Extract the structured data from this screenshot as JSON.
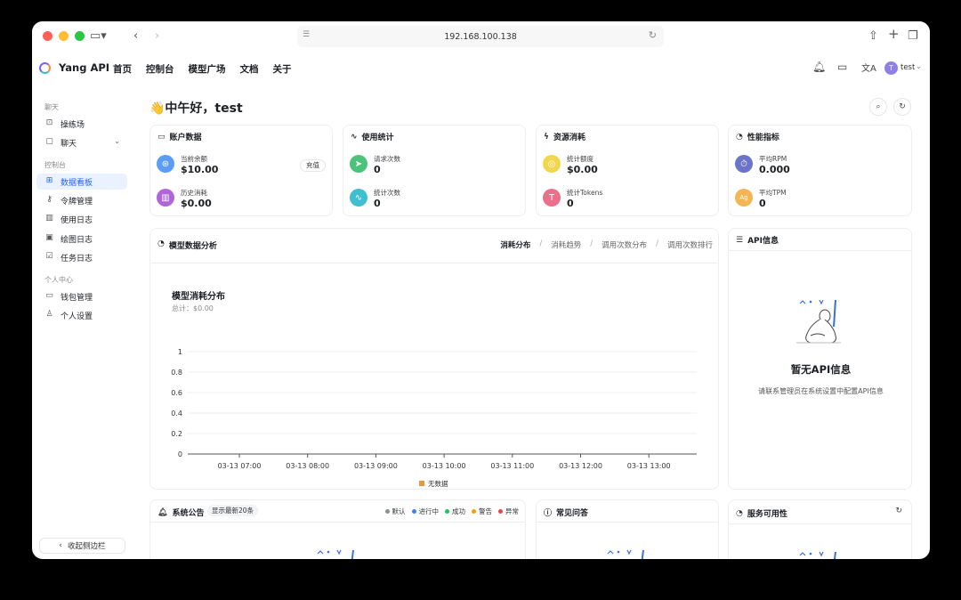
{
  "browser": {
    "url": "192.168.100.138"
  },
  "header": {
    "brand": "Yang API",
    "nav": [
      "首页",
      "控制台",
      "模型广场",
      "文档",
      "关于"
    ],
    "user_initial": "T",
    "user_name": "test"
  },
  "sidebar": {
    "sections": {
      "chat": "聊天",
      "console": "控制台",
      "personal": "个人中心"
    },
    "items": [
      {
        "label": "操练场",
        "icon": "playground-icon"
      },
      {
        "label": "聊天",
        "icon": "chat-icon"
      },
      {
        "label": "数据看板",
        "icon": "dashboard-icon",
        "active": true
      },
      {
        "label": "令牌管理",
        "icon": "key-icon"
      },
      {
        "label": "使用日志",
        "icon": "bar-chart-icon"
      },
      {
        "label": "绘图日志",
        "icon": "image-icon"
      },
      {
        "label": "任务日志",
        "icon": "check-square-icon"
      },
      {
        "label": "钱包管理",
        "icon": "wallet-icon"
      },
      {
        "label": "个人设置",
        "icon": "user-icon"
      }
    ],
    "collapse_label": "收起侧边栏"
  },
  "main": {
    "greeting": "👋中午好，test",
    "cards": {
      "account": {
        "title": "账户数据",
        "balance_label": "当前余额",
        "balance_value": "$10.00",
        "recharge": "充值",
        "history_label": "历史消耗",
        "history_value": "$0.00"
      },
      "usage": {
        "title": "使用统计",
        "requests_label": "请求次数",
        "requests_value": "0",
        "count_label": "统计次数",
        "count_value": "0"
      },
      "resource": {
        "title": "资源消耗",
        "quota_label": "统计额度",
        "quota_value": "$0.00",
        "tokens_label": "统计Tokens",
        "tokens_value": "0"
      },
      "performance": {
        "title": "性能指标",
        "rpm_label": "平均RPM",
        "rpm_value": "0.000",
        "tpm_label": "平均TPM",
        "tpm_value": "0"
      }
    },
    "analysis": {
      "title": "模型数据分析",
      "tabs": [
        "消耗分布",
        "消耗趋势",
        "调用次数分布",
        "调用次数排行"
      ],
      "chart_title": "模型消耗分布",
      "chart_subtitle": "总计：$0.00"
    },
    "api_info": {
      "title": "API信息",
      "empty_title": "暂无API信息",
      "empty_desc": "请联系管理员在系统设置中配置API信息"
    },
    "announcements": {
      "title": "系统公告",
      "badge": "显示最新20条",
      "legend": [
        {
          "label": "默认",
          "color": "#8a8f99"
        },
        {
          "label": "进行中",
          "color": "#3b82f6"
        },
        {
          "label": "成功",
          "color": "#22c55e"
        },
        {
          "label": "警告",
          "color": "#f59e0b"
        },
        {
          "label": "异常",
          "color": "#ef4444"
        }
      ]
    },
    "faq": {
      "title": "常见问答"
    },
    "availability": {
      "title": "服务可用性"
    }
  },
  "chart_data": {
    "type": "bar",
    "title": "模型消耗分布",
    "categories": [
      "03-13 07:00",
      "03-13 08:00",
      "03-13 09:00",
      "03-13 10:00",
      "03-13 11:00",
      "03-13 12:00",
      "03-13 13:00"
    ],
    "series": [
      {
        "name": "无数据",
        "values": [
          0,
          0,
          0,
          0,
          0,
          0,
          0
        ],
        "color": "#e8963a"
      }
    ],
    "yticks": [
      "0",
      "0.2",
      "0.4",
      "0.6",
      "0.8",
      "1"
    ],
    "ylim": [
      0,
      1
    ],
    "grid": true,
    "legend": "bottom"
  }
}
